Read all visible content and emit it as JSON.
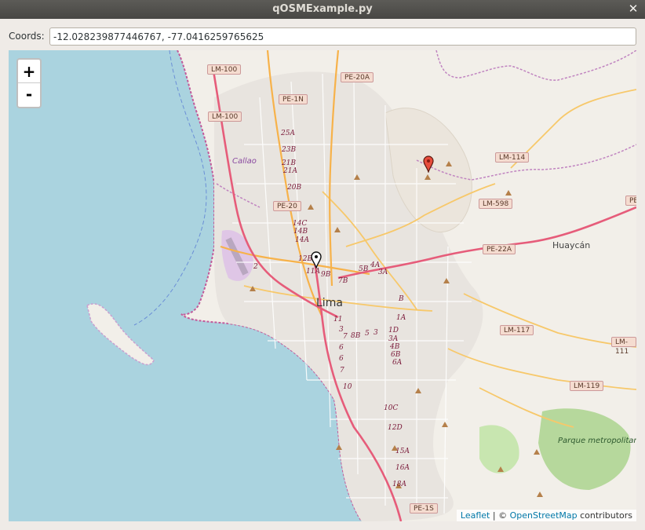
{
  "window": {
    "title": "qOSMExample.py",
    "close_glyph": "✕"
  },
  "coords": {
    "label": "Coords:",
    "value": "-12.028239877446767, -77.0416259765625"
  },
  "map": {
    "zoom_in": "+",
    "zoom_out": "-",
    "attribution": {
      "leaflet": "Leaflet",
      "separator": " | © ",
      "osm": "OpenStreetMap",
      "suffix": " contributors"
    },
    "labels": {
      "city": "Lima",
      "huaycan": "Huaycán",
      "callao": "Callao",
      "park": "Parque metropolitano Paul Paulet"
    },
    "shields": [
      "LM-100",
      "LM-100",
      "PE-1N",
      "PE-20A",
      "PE-20",
      "LM-114",
      "LM-598",
      "PE-22A",
      "LM-117",
      "LM-111",
      "LM-119",
      "PE-1S",
      "PE"
    ],
    "districts": [
      "25A",
      "23B",
      "21B",
      "21A",
      "20B",
      "14C",
      "14B",
      "14A",
      "12B",
      "11A",
      "9B",
      "7B",
      "5B",
      "4A",
      "3A",
      "B",
      "1A",
      "1D",
      "3A",
      "4B",
      "6B",
      "6A",
      "11",
      "3",
      "8B",
      "5",
      "3",
      "7",
      "6",
      "6",
      "7",
      "10",
      "10C",
      "12D",
      "15A",
      "16A",
      "18A",
      "2"
    ],
    "markers": {
      "red": "red-marker",
      "black": "black-marker"
    },
    "colors": {
      "water": "#aad3df",
      "land": "#f2efe9",
      "motorway": "#e892a2",
      "primary": "#fcd6a4",
      "park": "#c8e6b0"
    }
  }
}
